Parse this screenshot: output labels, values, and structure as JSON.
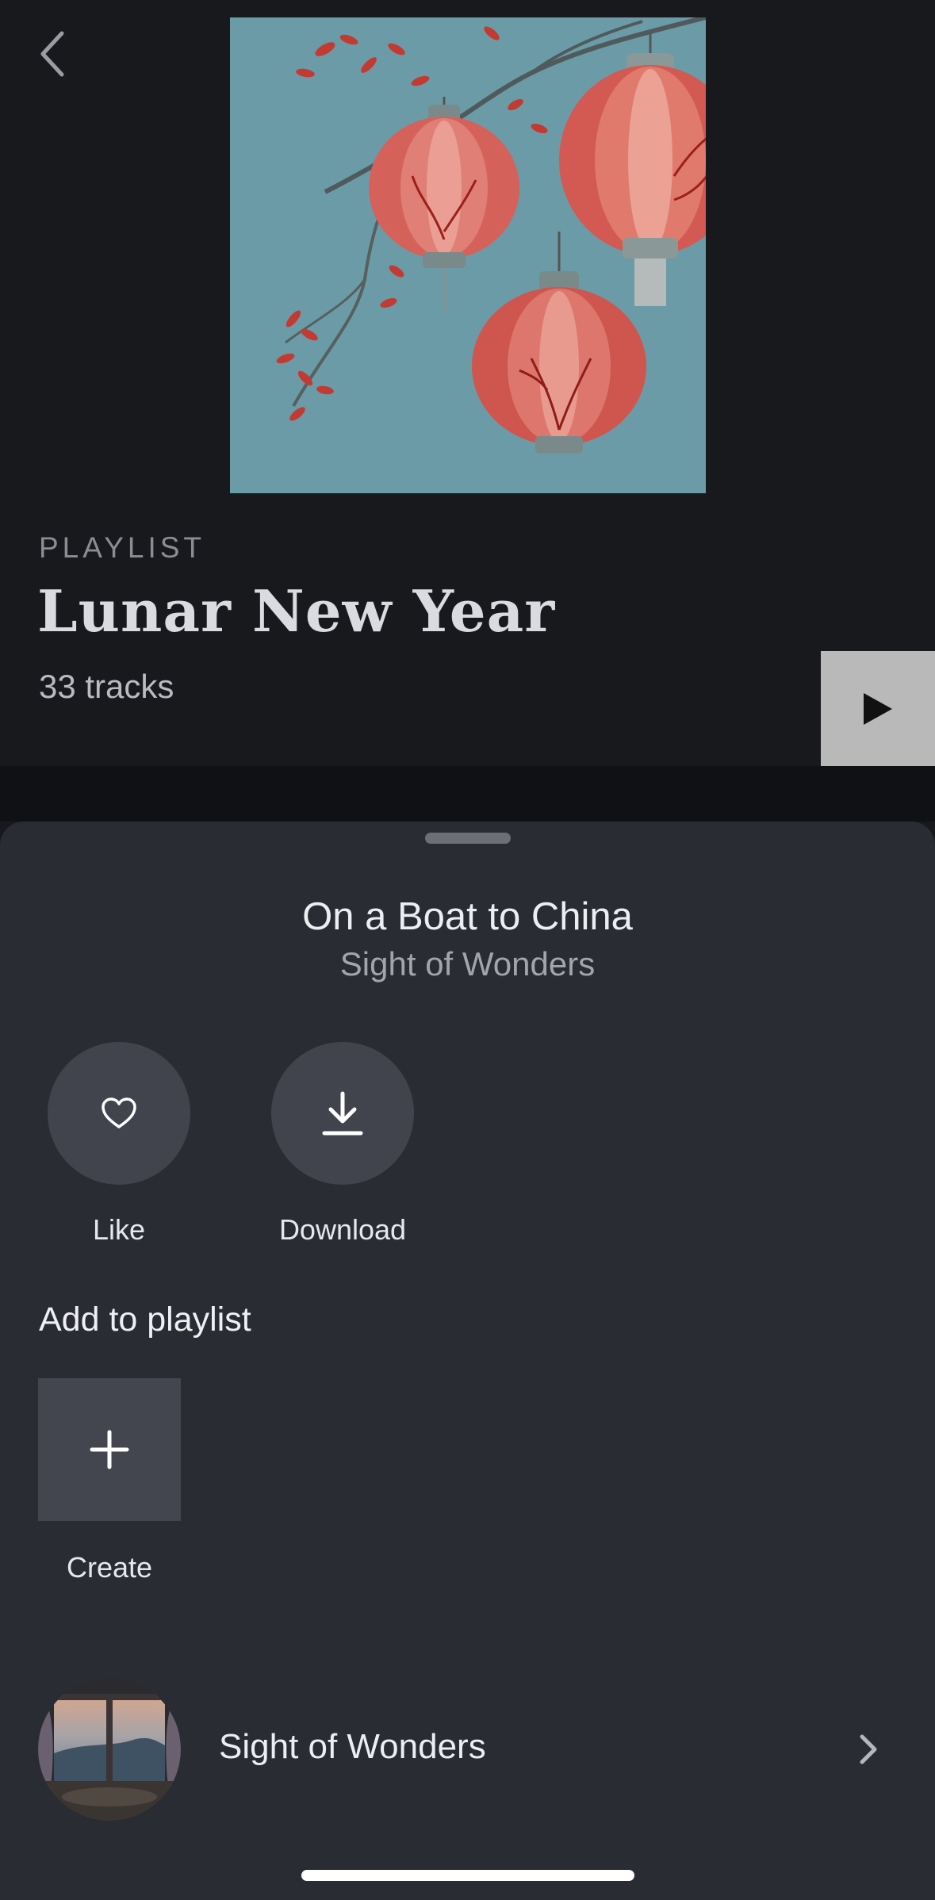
{
  "header": {
    "kicker": "PLAYLIST",
    "title": "Lunar New Year",
    "track_count": "33 tracks"
  },
  "icons": {
    "back": "chevron-left-icon",
    "play": "play-icon",
    "like": "heart-icon",
    "download": "download-icon",
    "create": "plus-icon",
    "artist_chevron": "chevron-right-icon"
  },
  "sheet": {
    "song_title": "On a Boat to China",
    "song_artist": "Sight of Wonders",
    "actions": {
      "like_label": "Like",
      "download_label": "Download"
    },
    "add_to_playlist": {
      "heading": "Add to playlist",
      "create_label": "Create"
    },
    "artist_row": {
      "name": "Sight of Wonders"
    }
  },
  "colors": {
    "background": "#18191d",
    "sheet": "#2a2c33",
    "circle_button": "#42444d",
    "cover_background": "#6b9ba7",
    "lantern_red": "#c94a43",
    "play_button": "#b9b9b9"
  }
}
